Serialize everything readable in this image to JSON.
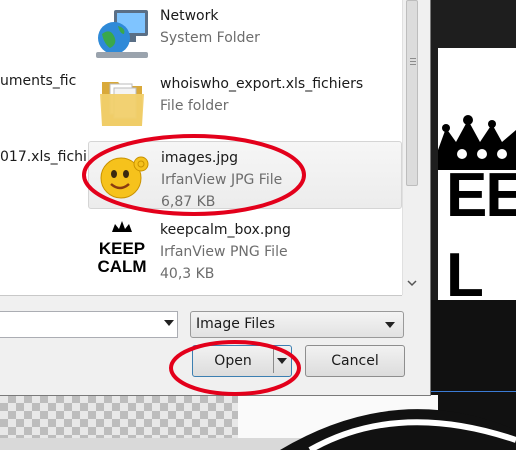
{
  "colors": {
    "annotation": "#e3001b",
    "focus": "#3c7fb1"
  },
  "left_pane": {
    "items": [
      {
        "label": "uments_fic"
      },
      {
        "label": "017.xls_fichi"
      }
    ]
  },
  "file_list": [
    {
      "name": "Network",
      "type": "System Folder",
      "size": "",
      "icon": "network-globe-icon"
    },
    {
      "name": "whoiswho_export.xls_fichiers",
      "type": "File folder",
      "size": "",
      "icon": "folder-icon"
    },
    {
      "name": "images.jpg",
      "type": "IrfanView JPG File",
      "size": "6,87 KB",
      "icon": "emoji-thumbnail"
    },
    {
      "name": "keepcalm_box.png",
      "type": "IrfanView PNG File",
      "size": "40,3 KB",
      "icon": "keep-calm-thumbnail"
    }
  ],
  "keep_calm_thumb": {
    "line1": "KEEP",
    "line2": "CALM"
  },
  "background": {
    "letters_top": "EE",
    "letters_bottom": "L"
  },
  "filename_input": {
    "value": ""
  },
  "file_type_select": {
    "selected": "Image Files"
  },
  "buttons": {
    "open": "Open",
    "cancel": "Cancel"
  }
}
